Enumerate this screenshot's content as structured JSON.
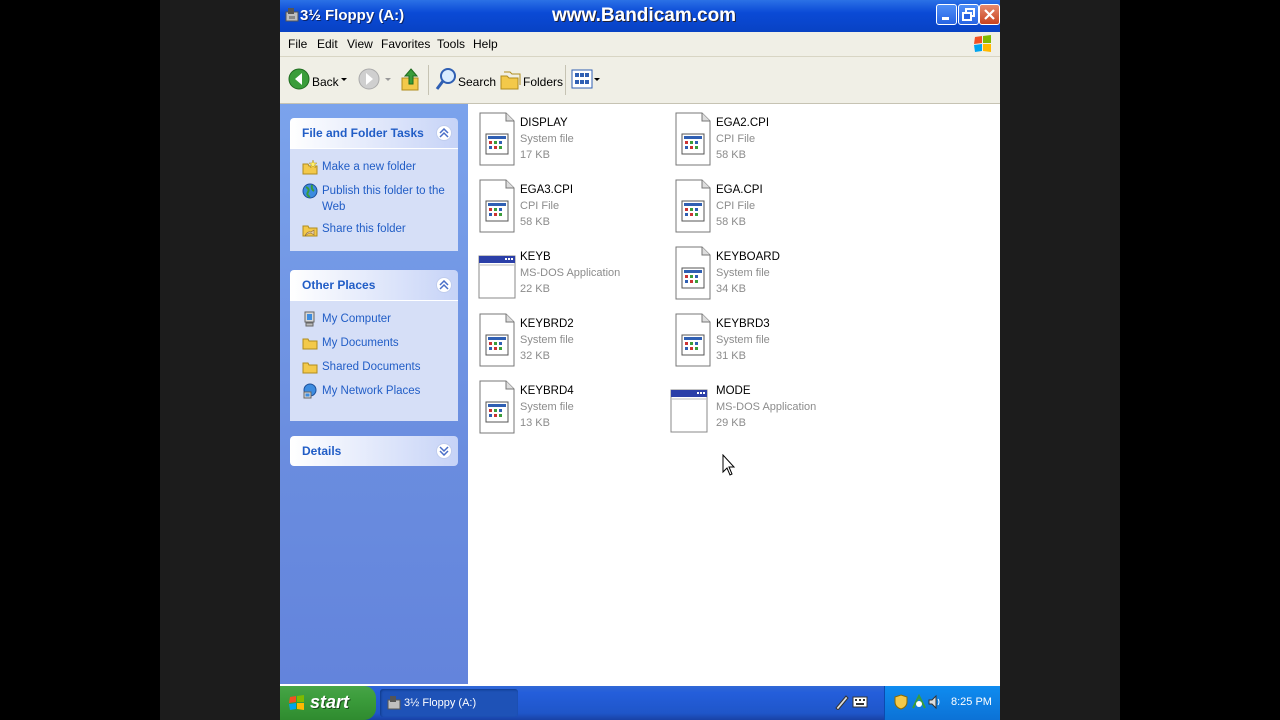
{
  "window": {
    "title": "3½ Floppy (A:)",
    "watermark": "www.Bandicam.com"
  },
  "menu": [
    "File",
    "Edit",
    "View",
    "Favorites",
    "Tools",
    "Help"
  ],
  "toolbar": {
    "back_label": "Back",
    "search_label": "Search",
    "folders_label": "Folders"
  },
  "taskpane": {
    "file_tasks": {
      "title": "File and Folder Tasks",
      "items": [
        {
          "label": "Make a new folder",
          "icon": "new-folder-icon"
        },
        {
          "label": "Publish this folder to the Web",
          "icon": "globe-icon"
        },
        {
          "label": "Share this folder",
          "icon": "share-folder-icon"
        }
      ]
    },
    "other_places": {
      "title": "Other Places",
      "items": [
        {
          "label": "My Computer",
          "icon": "computer-icon"
        },
        {
          "label": "My Documents",
          "icon": "folder-icon"
        },
        {
          "label": "Shared Documents",
          "icon": "folder-icon"
        },
        {
          "label": "My Network Places",
          "icon": "network-icon"
        }
      ]
    },
    "details": {
      "title": "Details"
    }
  },
  "files": [
    {
      "name": "DISPLAY",
      "type": "System file",
      "size": "17 KB",
      "icon": "system-file-icon"
    },
    {
      "name": "EGA2.CPI",
      "type": "CPI File",
      "size": "58 KB",
      "icon": "system-file-icon"
    },
    {
      "name": "EGA3.CPI",
      "type": "CPI File",
      "size": "58 KB",
      "icon": "system-file-icon"
    },
    {
      "name": "EGA.CPI",
      "type": "CPI File",
      "size": "58 KB",
      "icon": "system-file-icon"
    },
    {
      "name": "KEYB",
      "type": "MS-DOS Application",
      "size": "22 KB",
      "icon": "msdos-app-icon"
    },
    {
      "name": "KEYBOARD",
      "type": "System file",
      "size": "34 KB",
      "icon": "system-file-icon"
    },
    {
      "name": "KEYBRD2",
      "type": "System file",
      "size": "32 KB",
      "icon": "system-file-icon"
    },
    {
      "name": "KEYBRD3",
      "type": "System file",
      "size": "31 KB",
      "icon": "system-file-icon"
    },
    {
      "name": "KEYBRD4",
      "type": "System file",
      "size": "13 KB",
      "icon": "system-file-icon"
    },
    {
      "name": "MODE",
      "type": "MS-DOS Application",
      "size": "29 KB",
      "icon": "msdos-app-icon"
    }
  ],
  "taskbar": {
    "start_label": "start",
    "window_button_label": "3½ Floppy (A:)",
    "clock": "8:25 PM"
  },
  "colors": {
    "titlebar": "#0a4ad6",
    "taskpane": "#6a8ddf",
    "link": "#215dc6",
    "start": "#3b9c3b"
  }
}
